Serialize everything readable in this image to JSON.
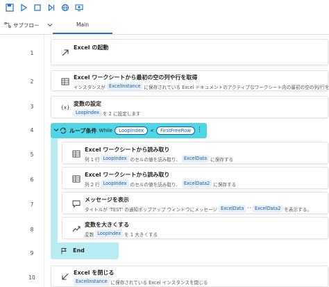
{
  "toolbar": {
    "icons": [
      "save-icon",
      "run-icon",
      "stop-icon",
      "step-icon",
      "web-recorder-icon",
      "desktop-recorder-icon"
    ]
  },
  "tabs": {
    "subflow_label": "サブフロー",
    "main_label": "Main"
  },
  "lines": [
    "1",
    "2",
    "3",
    "4",
    "5",
    "6",
    "7",
    "8",
    "9",
    "10"
  ],
  "actions": {
    "a1": {
      "title": "Excel の起動"
    },
    "a2": {
      "title": "Excel ワークシートから最初の空の列や行を取得",
      "desc_pre": "インスタンスが",
      "var1": "ExcelInstance",
      "desc_post": "に保存されている Excel ドキュメントのアクティブなワークシート内の最初の空の列/行を取得"
    },
    "a3": {
      "title": "変数の設定",
      "var1": "LoopIndex",
      "desc_post": "を 2 に設定します"
    },
    "a4": {
      "title": "ループ条件",
      "while": "While",
      "var1": "LoopIndex",
      "op": "<",
      "var2": "FirstFreeRow"
    },
    "a5": {
      "title": "Excel ワークシートから読み取り",
      "desc_pre": "列 1 行",
      "var1": "LoopIndex",
      "desc_mid": "のセルの値を読み取り、",
      "var2": "ExcelData",
      "desc_post": "に保存する"
    },
    "a6": {
      "title": "Excel ワークシートから読み取り",
      "desc_pre": "列 2 行",
      "var1": "LoopIndex",
      "desc_mid": "のセルの値を読み取り、",
      "var2": "ExcelData2",
      "desc_post": "に保存する"
    },
    "a7": {
      "title": "メッセージを表示",
      "desc_pre": "タイトルが 'TEST' の通知ポップアップ ウィンドウにメッセージ",
      "var1": "ExcelData",
      "desc_mid": "' '",
      "var2": "ExcelData2",
      "desc_post": "を表示する。"
    },
    "a8": {
      "title": "変数を大きくする",
      "desc_pre": "変数",
      "var1": "LoopIndex",
      "desc_post": "を 1 大きくする"
    },
    "a9": {
      "title": "End"
    },
    "a10": {
      "title": "Excel を閉じる",
      "var1": "ExcelInstance",
      "desc_post": "に保存されている Excel インスタンスを閉じる"
    }
  },
  "colors": {
    "loop_header": "#4fd6e6",
    "loop_body": "#b8ecf3",
    "accent": "#1e6fd1",
    "variable_pill": "#e6f0fb"
  }
}
